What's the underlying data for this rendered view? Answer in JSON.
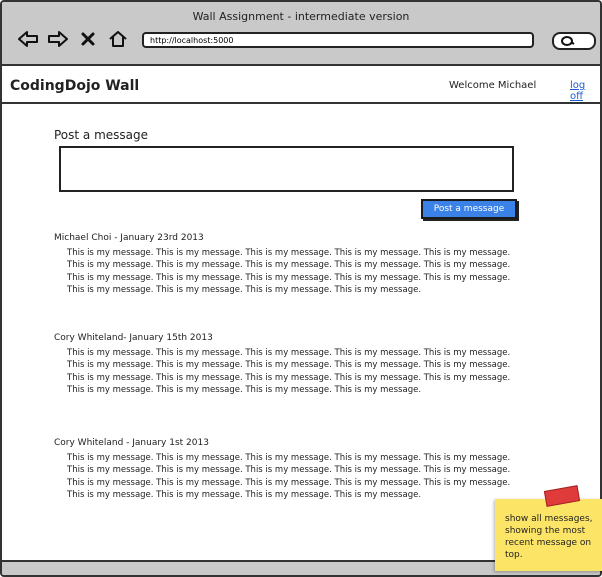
{
  "window": {
    "title": "Wall Assignment - intermediate version",
    "url": "http://localhost:5000"
  },
  "nav_icons": [
    "back-arrow-icon",
    "forward-arrow-icon",
    "stop-icon",
    "home-icon",
    "search-icon"
  ],
  "header": {
    "brand": "CodingDojo Wall",
    "welcome": "Welcome Michael",
    "logoff": "log off"
  },
  "post": {
    "label": "Post a message",
    "textarea_value": "",
    "button_label": "Post a message"
  },
  "messages": [
    {
      "meta": "Michael Choi - January 23rd 2013",
      "body": "This is my message. This is my message. This is my message. This is my message. This is my message. This is my message. This is my message. This is my message. This is my message. This is my message. This is my message. This is my message. This is my message. This is my message. This is my message. This is my message. This is my message. This is my message. This is my message."
    },
    {
      "meta": "Cory Whiteland- January 15th 2013",
      "body": "This is my message. This is my message. This is my message. This is my message. This is my message. This is my message. This is my message. This is my message. This is my message. This is my message. This is my message. This is my message. This is my message. This is my message. This is my message. This is my message. This is my message. This is my message. This is my message."
    },
    {
      "meta": "Cory Whiteland - January 1st 2013",
      "body": "This is my message. This is my message. This is my message. This is my message. This is my message. This is my message. This is my message. This is my message. This is my message. This is my message. This is my message. This is my message. This is my message. This is my message. This is my message. This is my message. This is my message. This is my message. This is my message."
    }
  ],
  "sticky_note": {
    "text": "show all messages, showing the most recent message on top."
  },
  "colors": {
    "chrome": "#c9c9c9",
    "button": "#3a82e8",
    "link": "#1e5bd1",
    "sticky": "#fce566",
    "tape": "#e03b3b"
  }
}
